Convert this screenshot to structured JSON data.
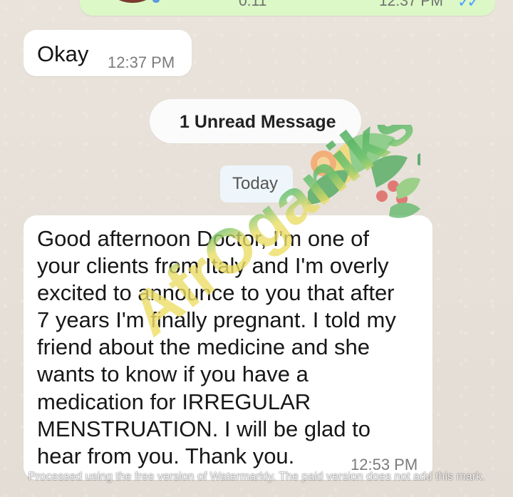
{
  "top_message": {
    "duration": "0:11",
    "time": "12:37 PM",
    "status_icon": "double-check-icon"
  },
  "messages": [
    {
      "text": "Okay",
      "time": "12:37 PM"
    },
    {
      "text": "Good afternoon Doctor, I'm one of\nyour clients from Italy and I'm overly\nexcited to announce to you that after\n7 years I'm finally pregnant. I told my\nfriend about the medicine and she\nwants to know if you have a\nmedication for IRREGULAR\nMENSTRUATION. I will be glad to\nhear from you. Thank you.",
      "time": "12:53 PM"
    }
  ],
  "unread_banner": {
    "label": "1 Unread Message"
  },
  "date_separator": {
    "label": "Today"
  },
  "watermark": {
    "logo_text": "AfrOganiks",
    "bottom_notice": "Processed using the free version of Watermarkly. The paid version does not add this mark."
  },
  "colors": {
    "chat_background": "#e6dfd7",
    "incoming_bubble": "#ffffff",
    "outgoing_bubble": "#dcf8c6",
    "read_tick": "#4aa3ff",
    "logo_yellow": "#f1dc72",
    "logo_green": "#6cc26f",
    "logo_dark_green": "#2f9a4c",
    "logo_red": "#de5a57",
    "logo_orange": "#f2a15c"
  }
}
